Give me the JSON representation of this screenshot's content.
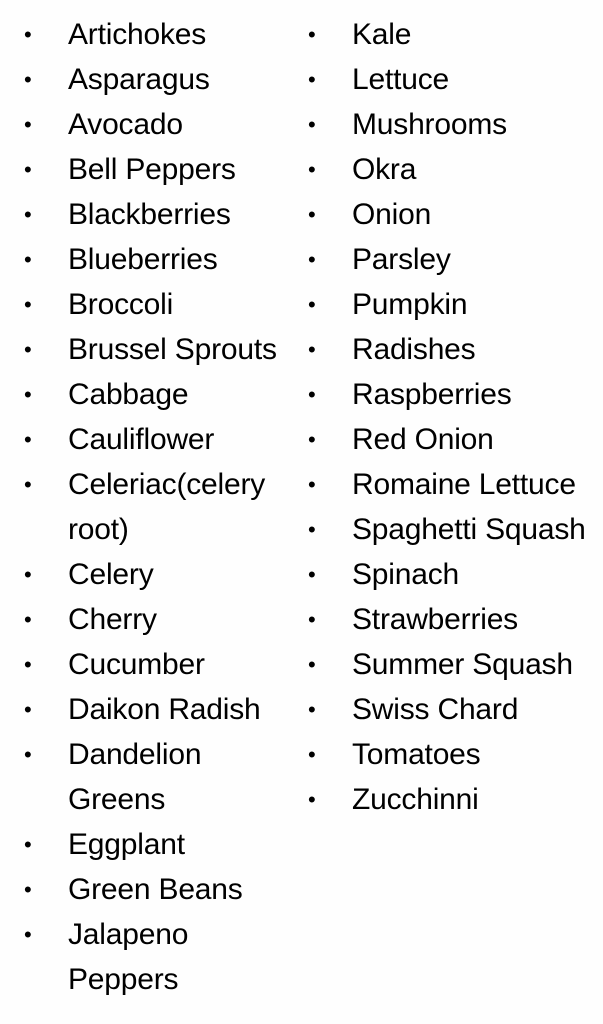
{
  "document": {
    "type": "two-column-bulleted-list",
    "bullet_glyph": "•",
    "text_color": "#000000",
    "background_color": "#fefefe"
  },
  "columns": [
    {
      "name": "left-column",
      "items": [
        {
          "label": "Artichokes"
        },
        {
          "label": "Asparagus"
        },
        {
          "label": "Avocado"
        },
        {
          "label": "Bell Peppers"
        },
        {
          "label": "Blackberries"
        },
        {
          "label": "Blueberries"
        },
        {
          "label": "Broccoli"
        },
        {
          "label": "Brussel Sprouts"
        },
        {
          "label": "Cabbage"
        },
        {
          "label": "Cauliflower"
        },
        {
          "label": "Celeriac(celery root)"
        },
        {
          "label": "Celery"
        },
        {
          "label": "Cherry"
        },
        {
          "label": "Cucumber"
        },
        {
          "label": "Daikon Radish"
        },
        {
          "label": "Dandelion Greens"
        },
        {
          "label": "Eggplant"
        },
        {
          "label": "Green Beans"
        },
        {
          "label": "Jalapeno Peppers"
        }
      ]
    },
    {
      "name": "right-column",
      "items": [
        {
          "label": "Kale"
        },
        {
          "label": "Lettuce"
        },
        {
          "label": "Mushrooms"
        },
        {
          "label": "Okra"
        },
        {
          "label": "Onion"
        },
        {
          "label": "Parsley"
        },
        {
          "label": "Pumpkin"
        },
        {
          "label": "Radishes"
        },
        {
          "label": "Raspberries"
        },
        {
          "label": "Red Onion"
        },
        {
          "label": "Romaine Lettuce"
        },
        {
          "label": "Spaghetti Squash"
        },
        {
          "label": "Spinach"
        },
        {
          "label": "Strawberries"
        },
        {
          "label": "Summer Squash"
        },
        {
          "label": "Swiss Chard"
        },
        {
          "label": "Tomatoes"
        },
        {
          "label": "Zucchinni"
        }
      ]
    }
  ]
}
